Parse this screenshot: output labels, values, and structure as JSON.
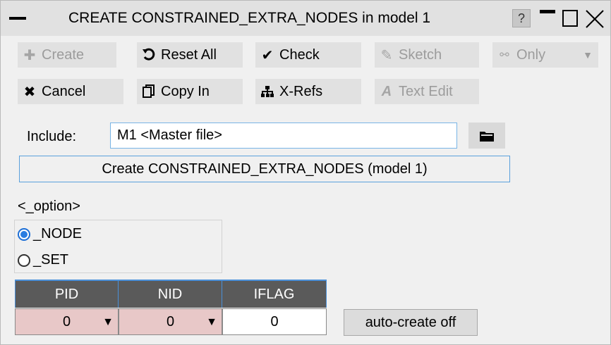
{
  "window": {
    "title": "CREATE CONSTRAINED_EXTRA_NODES in model 1",
    "help_label": "?"
  },
  "toolbar": {
    "create": "Create",
    "reset_all": "Reset All",
    "check": "Check",
    "sketch": "Sketch",
    "only": "Only",
    "cancel": "Cancel",
    "copy_in": "Copy In",
    "x_refs": "X-Refs",
    "text_edit": "Text Edit"
  },
  "include": {
    "label": "Include:",
    "value": "M1  <Master file>"
  },
  "create_header": "Create CONSTRAINED_EXTRA_NODES (model 1)",
  "option": {
    "label": "<_option>",
    "items": [
      {
        "label": "_NODE",
        "selected": true
      },
      {
        "label": "_SET",
        "selected": false
      }
    ]
  },
  "grid": {
    "headers": [
      "PID",
      "NID",
      "IFLAG"
    ],
    "values": [
      "0",
      "0",
      "0"
    ]
  },
  "auto_create": "auto-create off",
  "colors": {
    "accent_blue": "#2a7de1",
    "header_bg": "#5a5a5a",
    "dropdown_cell_bg": "#e8c8c8"
  }
}
